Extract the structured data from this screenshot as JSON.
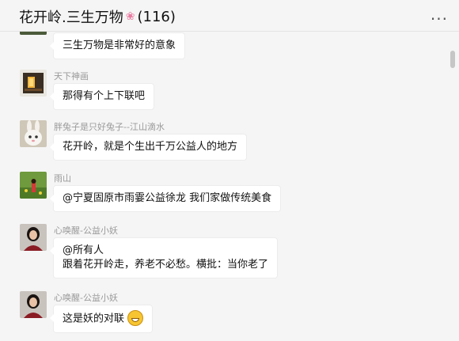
{
  "window": {
    "title_main": "花开岭.三生万物",
    "member_count": "(116)",
    "more_label": "..."
  },
  "messages": [
    {
      "sender": "",
      "lines": [
        "三生万物是非常好的意象"
      ]
    },
    {
      "sender": "天下神画",
      "lines": [
        "那得有个上下联吧"
      ]
    },
    {
      "sender": "胖兔子是只好兔子--江山滴水",
      "lines": [
        "花开岭，就是个生出千万公益人的地方"
      ]
    },
    {
      "sender": "雨山",
      "lines": [
        "@宁夏固原市雨霎公益徐龙 我们家做传统美食"
      ]
    },
    {
      "sender": "心唤醒-公益小妖",
      "lines": [
        "@所有人",
        "跟着花开岭走，养老不必愁。横批：当你老了"
      ]
    },
    {
      "sender": "心唤醒-公益小妖",
      "lines": [
        "这是妖的对联"
      ]
    }
  ],
  "colors": {
    "background": "#f5f5f5",
    "bubble": "#ffffff",
    "sender_name": "#9a9a9a"
  },
  "icons": [
    "flower-icon",
    "more-icon",
    "grinning-emoji-icon"
  ]
}
